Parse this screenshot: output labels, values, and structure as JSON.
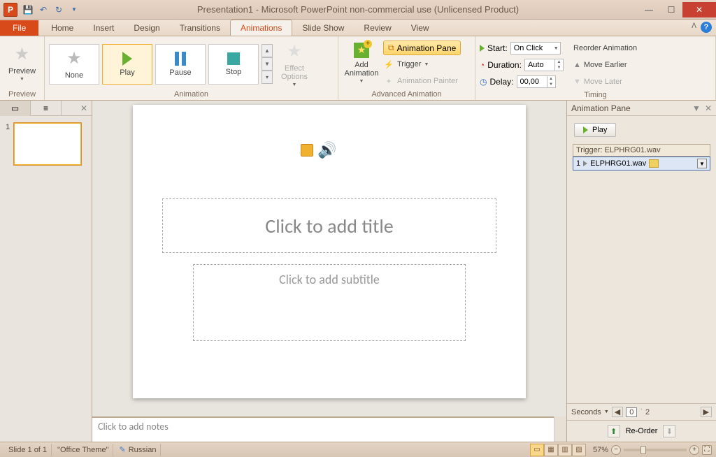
{
  "title": "Presentation1 - Microsoft PowerPoint non-commercial use (Unlicensed Product)",
  "tabs": {
    "file": "File",
    "home": "Home",
    "insert": "Insert",
    "design": "Design",
    "transitions": "Transitions",
    "animations": "Animations",
    "slideshow": "Slide Show",
    "review": "Review",
    "view": "View"
  },
  "ribbon": {
    "preview": {
      "btn": "Preview",
      "group": "Preview"
    },
    "anim": {
      "none": "None",
      "play": "Play",
      "pause": "Pause",
      "stop": "Stop",
      "group": "Animation",
      "effect_options": "Effect\nOptions"
    },
    "adv": {
      "add": "Add\nAnimation",
      "pane": "Animation Pane",
      "trigger": "Trigger",
      "painter": "Animation Painter",
      "group": "Advanced Animation"
    },
    "timing": {
      "start_lbl": "Start:",
      "start_val": "On Click",
      "dur_lbl": "Duration:",
      "dur_val": "Auto",
      "delay_lbl": "Delay:",
      "delay_val": "00,00",
      "reorder": "Reorder Animation",
      "earlier": "Move Earlier",
      "later": "Move Later",
      "group": "Timing"
    }
  },
  "slide": {
    "title_ph": "Click to add title",
    "sub_ph": "Click to add subtitle",
    "notes_ph": "Click to add notes"
  },
  "anim_pane": {
    "title": "Animation Pane",
    "play": "Play",
    "trigger_lbl": "Trigger: ELPHRG01.wav",
    "item_idx": "1",
    "item_name": "ELPHRG01.wav",
    "seconds": "Seconds",
    "timeline_cur": "0",
    "timeline_mark": "2",
    "reorder": "Re-Order"
  },
  "thumb": {
    "num": "1"
  },
  "status": {
    "slide": "Slide 1 of 1",
    "theme": "\"Office Theme\"",
    "lang": "Russian",
    "zoom": "57%"
  }
}
